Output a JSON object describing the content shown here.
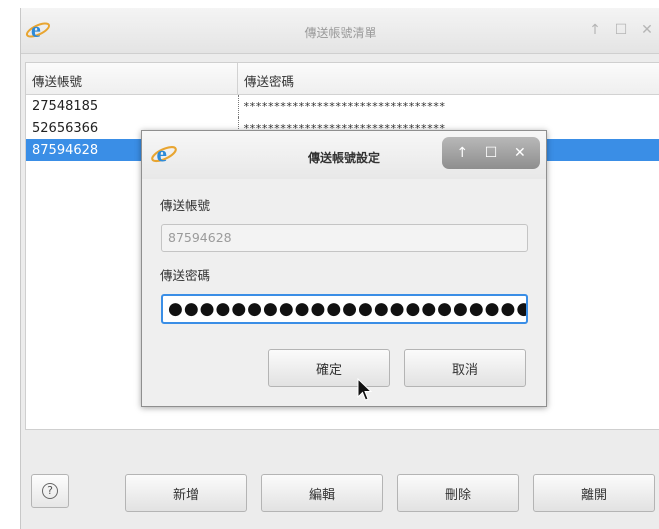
{
  "main_window": {
    "title": "傳送帳號清單",
    "title_buttons": [
      "↑",
      "☐",
      "✕"
    ]
  },
  "table": {
    "headers": [
      "傳送帳號",
      "傳送密碼"
    ],
    "rows": [
      {
        "account": "27548185",
        "password": "*********************************"
      },
      {
        "account": "52656366",
        "password": "*********************************"
      },
      {
        "account": "87594628",
        "password": ""
      }
    ],
    "selected_index": 2
  },
  "bottom_buttons": {
    "help": "?",
    "add": "新增",
    "edit": "編輯",
    "delete": "刪除",
    "exit": "離開"
  },
  "dialog": {
    "title": "傳送帳號設定",
    "title_buttons": [
      "↑",
      "☐",
      "✕"
    ],
    "account_label": "傳送帳號",
    "account_value": "87594628",
    "password_label": "傳送密碼",
    "password_value": "●●●●●●●●●●●●●●●●●●●●●●●●●●●●●●●",
    "ok": "確定",
    "cancel": "取消"
  },
  "colors": {
    "selection": "#3a8ee6",
    "focus": "#3a8ee6"
  },
  "icons": {
    "app": "browser-e-icon",
    "help": "question-circle-icon",
    "cursor": "mouse-pointer-icon"
  }
}
